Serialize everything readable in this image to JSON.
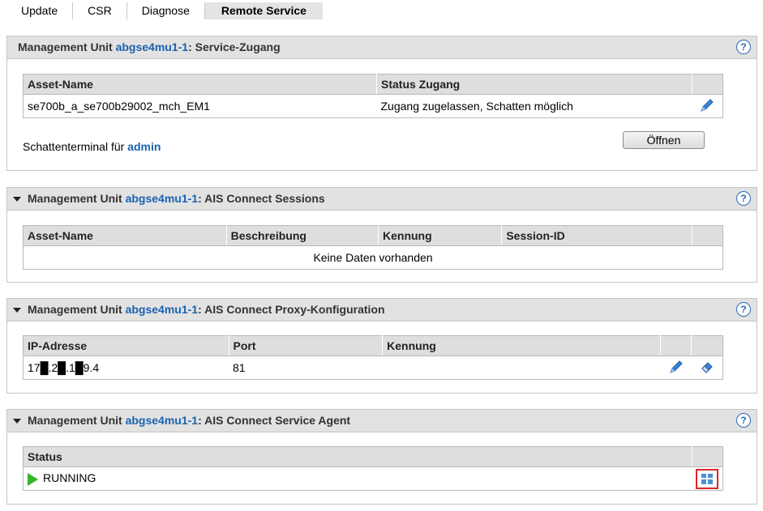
{
  "tabs": [
    "Update",
    "CSR",
    "Diagnose",
    "Remote Service"
  ],
  "active_tab": "Remote Service",
  "unit": "abgse4mu1-1",
  "panels": {
    "service_access": {
      "prefix": "Management Unit ",
      "suffix": ": Service-Zugang",
      "columns": [
        "Asset-Name",
        "Status Zugang"
      ],
      "row": {
        "asset": "se700b_a_se700b29002_mch_EM1",
        "status": "Zugang zugelassen, Schatten möglich"
      },
      "shadow_label": "Schattenterminal für ",
      "shadow_user": "admin",
      "open_button": "Öffnen"
    },
    "sessions": {
      "prefix": "Management Unit ",
      "suffix": ": AIS Connect Sessions",
      "columns": [
        "Asset-Name",
        "Beschreibung",
        "Kennung",
        "Session-ID"
      ],
      "empty_text": "Keine Daten vorhanden"
    },
    "proxy": {
      "prefix": "Management Unit ",
      "suffix": ": AIS Connect Proxy-Konfiguration",
      "columns": [
        "IP-Adresse",
        "Port",
        "Kennung"
      ],
      "row": {
        "ip": "17█.2█.1█9.4",
        "port": "81",
        "kennung": ""
      }
    },
    "agent": {
      "prefix": "Management Unit ",
      "suffix": ": AIS Connect Service Agent",
      "columns": [
        "Status"
      ],
      "row": {
        "status": "RUNNING"
      }
    }
  },
  "help_label": "?",
  "icons": [
    "pencil-icon",
    "eraser-icon",
    "help-icon",
    "collapse-arrow-icon",
    "running-arrow-icon",
    "agent-action-icon"
  ],
  "colors": {
    "link": "#1a62b0",
    "header_bg": "#e2e2e2",
    "running": "#34b52a",
    "highlight": "#e0242a"
  }
}
